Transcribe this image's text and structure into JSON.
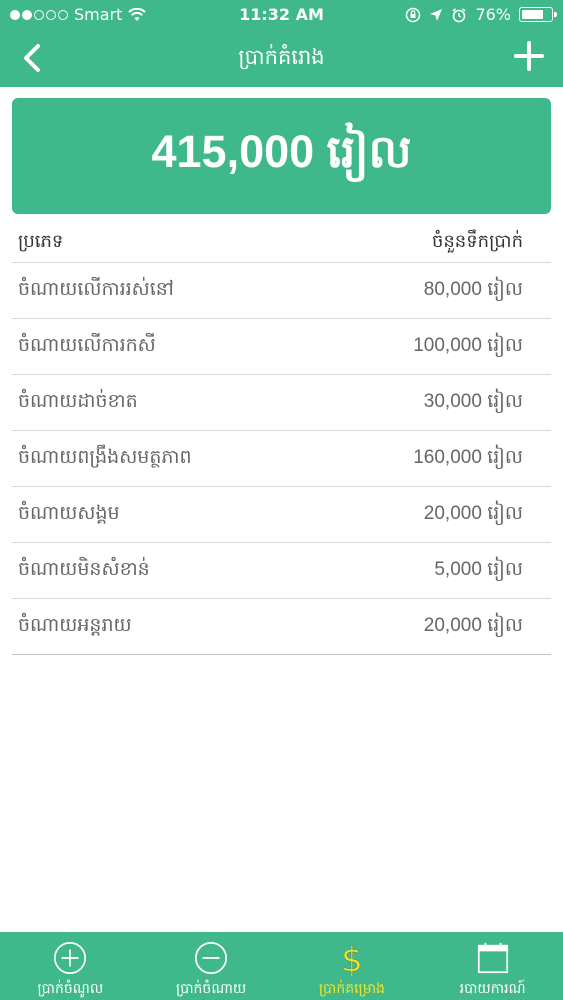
{
  "status_bar": {
    "carrier": "Smart",
    "time": "11:32 AM",
    "battery_percent": "76%",
    "battery_level": 0.76
  },
  "nav": {
    "title": "ប្រាក់គំរោង",
    "back_icon": "chevron-left-icon",
    "add_icon": "plus-icon"
  },
  "total": {
    "value": "415,000 រៀល"
  },
  "table": {
    "headers": {
      "type": "ប្រភេទ",
      "amount": "ចំនួនទឹកប្រាក់"
    },
    "rows": [
      {
        "type": "ចំណាយលើការរស់នៅ",
        "amount": "80,000 រៀល"
      },
      {
        "type": "ចំណាយលើការកសី",
        "amount": "100,000 រៀល"
      },
      {
        "type": "ចំណាយដាច់ខាត",
        "amount": "30,000 រៀល"
      },
      {
        "type": "ចំណាយពង្រឹងសមត្ថភាព",
        "amount": "160,000 រៀល"
      },
      {
        "type": "ចំណាយសង្គម",
        "amount": "20,000 រៀល"
      },
      {
        "type": "ចំណាយមិនសំខាន់",
        "amount": "5,000 រៀល"
      },
      {
        "type": "ចំណាយអន្តរាយ",
        "amount": "20,000 រៀល"
      }
    ]
  },
  "tabs": [
    {
      "label": "ប្រាក់ចំណូល",
      "icon": "plus-circle-icon",
      "active": false
    },
    {
      "label": "ប្រាក់ចំណាយ",
      "icon": "minus-circle-icon",
      "active": false
    },
    {
      "label": "ប្រាក់គម្រោង",
      "icon": "dollar-icon",
      "active": true
    },
    {
      "label": "របាយការណ៍",
      "icon": "calendar-icon",
      "active": false
    }
  ],
  "colors": {
    "brand_green": "#3fb98c",
    "active_tab": "#f4e324",
    "text_gray": "#666666"
  }
}
